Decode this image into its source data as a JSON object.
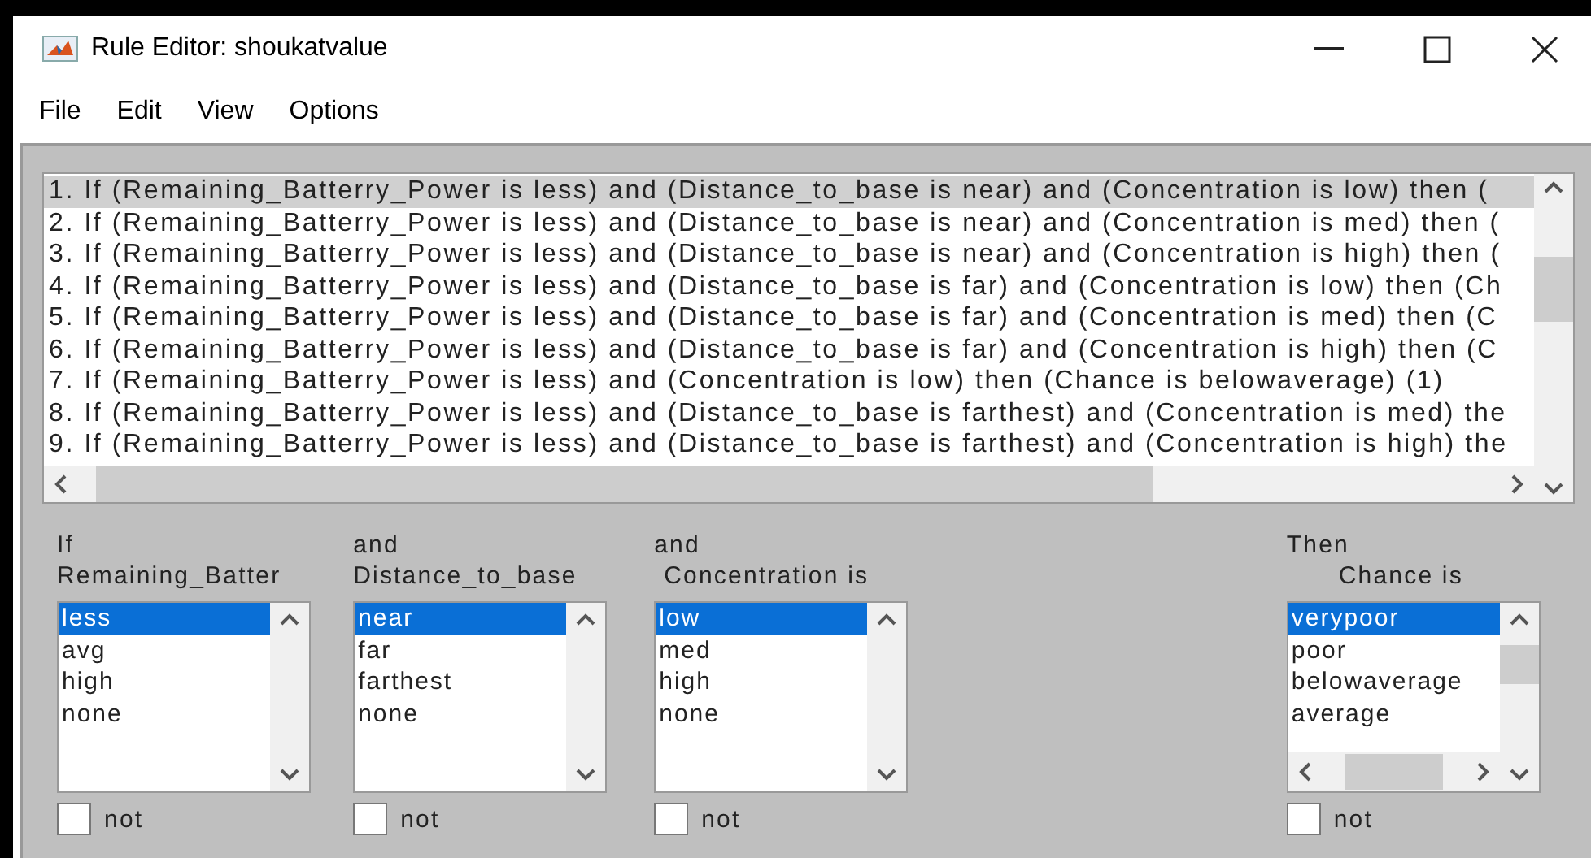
{
  "window": {
    "title": "Rule Editor: shoukatvalue"
  },
  "menu": [
    "File",
    "Edit",
    "View",
    "Options"
  ],
  "rules": [
    {
      "text": "1. If (Remaining_Batterry_Power is less) and (Distance_to_base is near) and (Concentration is low) then (",
      "selected": true
    },
    {
      "text": "2. If (Remaining_Batterry_Power is less) and (Distance_to_base is near) and (Concentration is med) then (",
      "selected": false
    },
    {
      "text": "3. If (Remaining_Batterry_Power is less) and (Distance_to_base is near) and (Concentration is high) then (",
      "selected": false
    },
    {
      "text": "4. If (Remaining_Batterry_Power is less) and (Distance_to_base is far) and (Concentration is low) then (Ch",
      "selected": false
    },
    {
      "text": "5. If (Remaining_Batterry_Power is less) and (Distance_to_base is far) and (Concentration is med) then (C",
      "selected": false
    },
    {
      "text": "6. If (Remaining_Batterry_Power is less) and (Distance_to_base is far) and (Concentration is high) then (C",
      "selected": false
    },
    {
      "text": "7. If (Remaining_Batterry_Power is less) and (Concentration is low) then (Chance is belowaverage) (1)",
      "selected": false
    },
    {
      "text": "8. If (Remaining_Batterry_Power is less) and (Distance_to_base is farthest) and (Concentration is med) the",
      "selected": false
    },
    {
      "text": "9. If (Remaining_Batterry_Power is less) and (Distance_to_base is farthest) and (Concentration is high) the",
      "selected": false
    }
  ],
  "variables": [
    {
      "connector": "If",
      "name": "Remaining_Batter",
      "kind": "input",
      "not": false,
      "not_label": "not",
      "items": [
        {
          "label": "less",
          "selected": true
        },
        {
          "label": "avg",
          "selected": false
        },
        {
          "label": "high",
          "selected": false
        },
        {
          "label": "none",
          "selected": false
        }
      ]
    },
    {
      "connector": "and",
      "name": "Distance_to_base",
      "kind": "input",
      "not": false,
      "not_label": "not",
      "items": [
        {
          "label": "near",
          "selected": true
        },
        {
          "label": "far",
          "selected": false
        },
        {
          "label": "farthest",
          "selected": false
        },
        {
          "label": "none",
          "selected": false
        }
      ]
    },
    {
      "connector": "and",
      "name": "Concentration is",
      "kind": "input",
      "not": false,
      "not_label": "not",
      "items": [
        {
          "label": "low",
          "selected": true
        },
        {
          "label": "med",
          "selected": false
        },
        {
          "label": "high",
          "selected": false
        },
        {
          "label": "none",
          "selected": false
        }
      ]
    },
    {
      "connector": "Then",
      "name": "Chance is",
      "kind": "output",
      "not": false,
      "not_label": "not",
      "items": [
        {
          "label": "verypoor",
          "selected": true
        },
        {
          "label": "poor",
          "selected": false
        },
        {
          "label": "belowaverage",
          "selected": false
        },
        {
          "label": "average",
          "selected": false
        }
      ]
    }
  ]
}
